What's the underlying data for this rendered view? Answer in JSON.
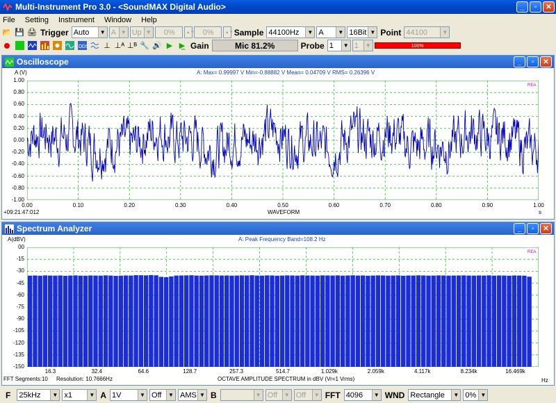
{
  "window": {
    "title": "Multi-Instrument Pro 3.0 - <SoundMAX Digital Audio>"
  },
  "menu": [
    "File",
    "Setting",
    "Instrument",
    "Window",
    "Help"
  ],
  "toolbar1": {
    "trigger_label": "Trigger",
    "trigger_mode": "Auto",
    "channel": "A",
    "edge": "Up",
    "level1": "0%",
    "level2": "0%",
    "sample_label": "Sample",
    "sample_rate": "44100Hz",
    "sample_channel": "A",
    "bits": "16Bit",
    "point_label": "Point",
    "points": "44100"
  },
  "toolbar2": {
    "gain_label": "Gain",
    "mic_level": "Mic 81.2%",
    "probe_label": "Probe",
    "probe_a": "1",
    "probe_b": "1",
    "level_bar": "100%",
    "level_fraction": 1.0
  },
  "oscilloscope": {
    "title": "Oscilloscope",
    "ylabel": "A (V)",
    "stats": "A: Max= 0.99997 V  Min=-0.88882 V  Mean= 0.04709 V  RMS= 0.26396 V",
    "y_ticks": [
      "1.00",
      "0.80",
      "0.60",
      "0.40",
      "0.20",
      "0.00",
      "-0.20",
      "-0.40",
      "-0.60",
      "-0.80",
      "-1.00"
    ],
    "x_ticks": [
      "0.00",
      "0.10",
      "0.20",
      "0.30",
      "0.40",
      "0.50",
      "0.60",
      "0.70",
      "0.80",
      "0.90",
      "1.00"
    ],
    "x_unit": "s",
    "timestamp": "+09:21:47:012",
    "xlabel": "WAVEFORM",
    "corner_label": "REA"
  },
  "spectrum": {
    "title": "Spectrum Analyzer",
    "ylabel": "A(dBV)",
    "stats": "A: Peak Frequency Band=108.2 Hz",
    "y_ticks": [
      "00",
      "-15",
      "-30",
      "-45",
      "-60",
      "-75",
      "-90",
      "-105",
      "-120",
      "-135",
      "-150"
    ],
    "x_ticks": [
      "16.3",
      "32.4",
      "64.6",
      "128.7",
      "257.3",
      "514.7",
      "1.029k",
      "2.059k",
      "4.117k",
      "8.234k",
      "16.469k"
    ],
    "x_unit": "Hz",
    "segments": "FFT Segments:10",
    "resolution": "Resolution: 10.7666Hz",
    "xlabel": "OCTAVE AMPLITUDE SPECTRUM in dBV (Vr=1 Vrms)",
    "corner_label": "REA"
  },
  "chart_data": [
    {
      "type": "line",
      "title": "",
      "xlabel": "WAVEFORM",
      "ylabel": "A (V)",
      "xlim": [
        0,
        1.0
      ],
      "ylim": [
        -1.0,
        1.0
      ],
      "grid": true,
      "series": [
        {
          "name": "A",
          "color": "#0000c0"
        }
      ]
    },
    {
      "type": "bar",
      "title": "",
      "xlabel": "OCTAVE AMPLITUDE SPECTRUM in dBV (Vr=1 Vrms)",
      "ylabel": "A(dBV)",
      "ylim": [
        -150,
        0
      ],
      "grid": true,
      "bar_count": 100,
      "values": [
        -35.5,
        -35.3,
        -35.6,
        -35.2,
        -35.4,
        -35.5,
        -35.3,
        -35.7,
        -35.4,
        -35.2,
        -35.5,
        -35.6,
        -35.3,
        -35.4,
        -35.5,
        -35.2,
        -35.4,
        -35.8,
        -35.5,
        -35.3,
        -35.4,
        -34.9,
        -35.0,
        -35.2,
        -34.8,
        -35.1,
        -37.0,
        -37.5,
        -36.5,
        -35.4,
        -35.3,
        -35.2,
        -35.0,
        -35.4,
        -35.5,
        -35.3,
        -35.1,
        -35.2,
        -35.4,
        -35.3,
        -35.5,
        -35.4,
        -35.2,
        -35.3,
        -35.0,
        -35.4,
        -35.5,
        -35.2,
        -35.3,
        -35.6,
        -35.4,
        -35.2,
        -35.3,
        -35.5,
        -35.1,
        -35.3,
        -35.4,
        -35.5,
        -35.2,
        -35.3,
        -35.4,
        -35.2,
        -35.5,
        -35.3,
        -35.1,
        -35.4,
        -35.3,
        -35.6,
        -35.4,
        -35.2,
        -35.3,
        -35.5,
        -35.4,
        -35.2,
        -35.6,
        -35.3,
        -35.4,
        -35.1,
        -35.3,
        -35.5,
        -35.4,
        -35.2,
        -35.3,
        -35.5,
        -35.4,
        -35.3,
        -35.2,
        -35.4,
        -35.5,
        -35.3,
        -35.4,
        -35.2,
        -35.5,
        -35.3,
        -35.4,
        -35.6,
        -35.3,
        -35.4,
        -35.5,
        -36.8
      ],
      "bar_color": "#1a2dd6"
    }
  ],
  "statusbar": {
    "f_label": "F",
    "freq_range": "25kHz",
    "mult": "x1",
    "a_label": "A",
    "a_scale": "1V",
    "a_off": "Off",
    "ams": "AMS",
    "b_label": "B",
    "b_off1": "Off",
    "b_off2": "Off",
    "fft_label": "FFT",
    "fft_size": "4096",
    "wnd_label": "WND",
    "window": "Rectangle",
    "overlap": "0%"
  }
}
